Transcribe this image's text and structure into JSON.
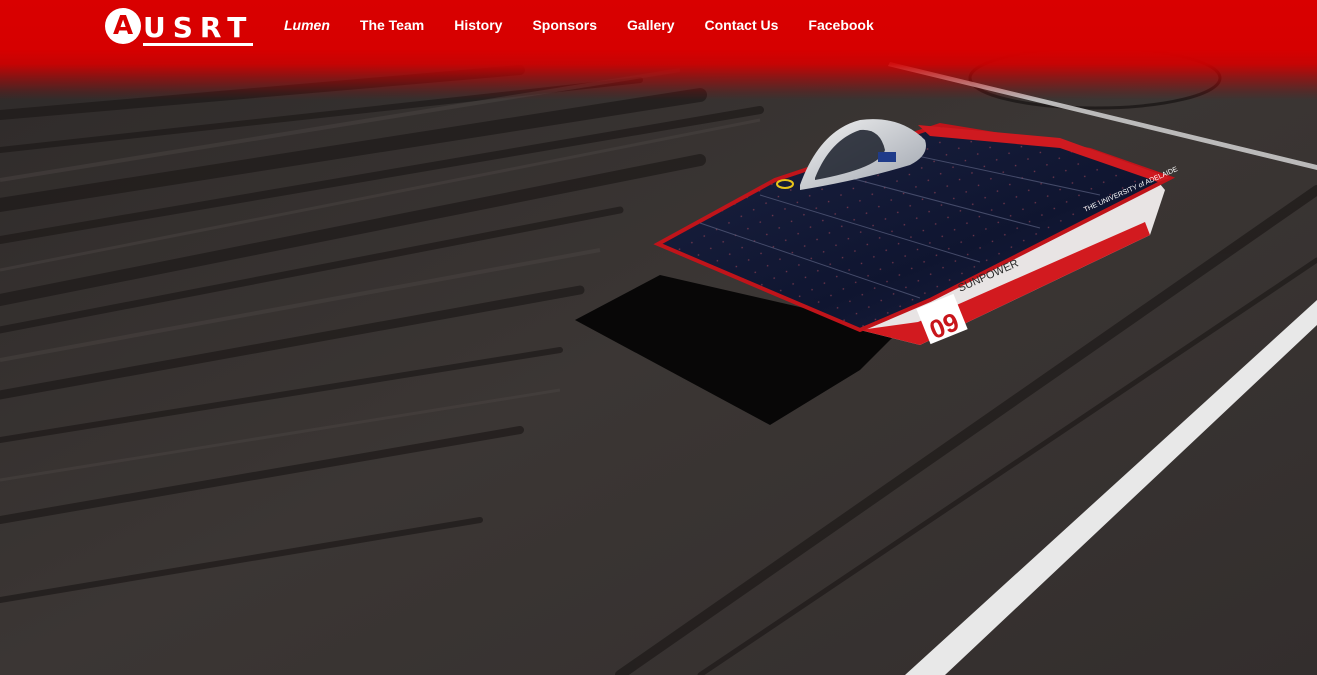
{
  "brand": {
    "logo_letter": "A",
    "logo_text": "USRT",
    "primary_color": "#d90000",
    "text_color": "#ffffff"
  },
  "nav": {
    "items": [
      {
        "label": "Lumen",
        "active": true
      },
      {
        "label": "The Team",
        "active": false
      },
      {
        "label": "History",
        "active": false
      },
      {
        "label": "Sponsors",
        "active": false
      },
      {
        "label": "Gallery",
        "active": false
      },
      {
        "label": "Contact Us",
        "active": false
      },
      {
        "label": "Facebook",
        "active": false
      }
    ]
  },
  "hero": {
    "image_subject": "solar-car-on-track",
    "car": {
      "race_number": "09",
      "side_text": "SUNPOWER",
      "sponsor_text": "THE UNIVERSITY of ADELAIDE"
    }
  }
}
